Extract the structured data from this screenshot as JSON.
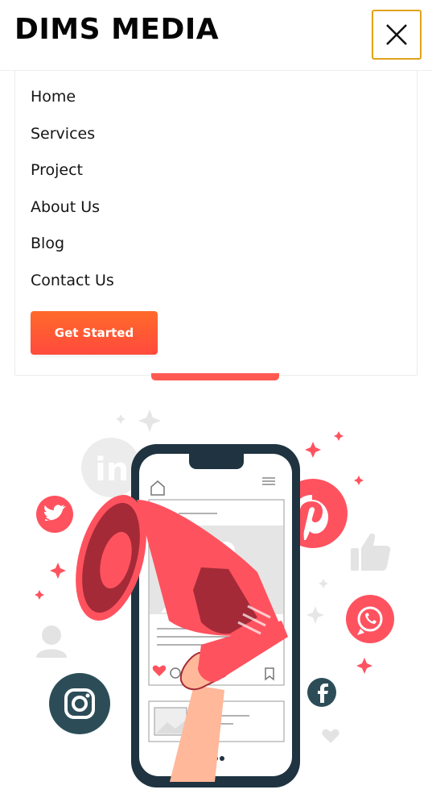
{
  "header": {
    "logo_text": "DIMS MEDIA",
    "close_icon": "close-icon",
    "accent_border": "#e0a21a"
  },
  "menu": {
    "items": [
      {
        "label": "Home"
      },
      {
        "label": "Services"
      },
      {
        "label": "Project"
      },
      {
        "label": "About Us"
      },
      {
        "label": "Blog"
      },
      {
        "label": "Contact Us"
      }
    ],
    "cta_label": "Get Started",
    "cta_color_start": "#ff6a2a",
    "cta_color_end": "#ff4a3d"
  },
  "illustration": {
    "subject": "social-media-marketing-megaphone-phone",
    "icons": [
      "linkedin-icon",
      "twitter-icon",
      "pinterest-icon",
      "whatsapp-icon",
      "instagram-icon",
      "facebook-icon",
      "thumbs-up-icon",
      "user-icon",
      "heart-icon"
    ],
    "accent": "#ff525f",
    "dark": "#1f3340"
  }
}
